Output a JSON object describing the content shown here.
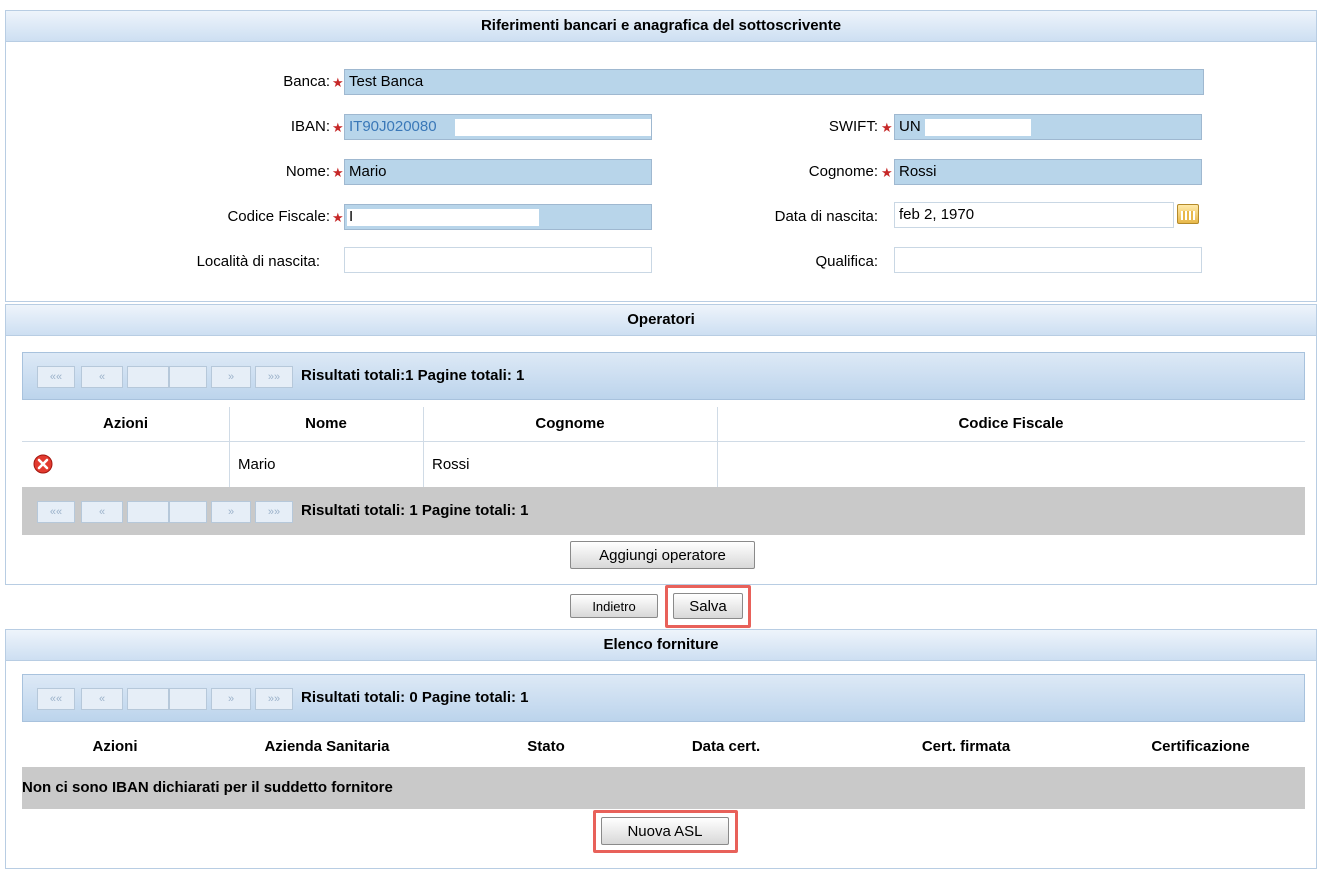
{
  "section1": {
    "title": "Riferimenti bancari e anagrafica del sottoscrivente",
    "banca_label": "Banca:",
    "banca_value": "Test Banca",
    "iban_label": "IBAN:",
    "iban_value": "IT90J020080",
    "swift_label": "SWIFT:",
    "swift_value": "UN",
    "nome_label": "Nome:",
    "nome_value": "Mario",
    "cognome_label": "Cognome:",
    "cognome_value": "Rossi",
    "cf_label": "Codice Fiscale:",
    "cf_value": "I",
    "data_label": "Data di nascita:",
    "data_value": "feb 2, 1970",
    "localita_label": "Località di nascita:",
    "localita_value": "",
    "qualifica_label": "Qualifica:",
    "qualifica_value": "",
    "required_mark": "★"
  },
  "operatori": {
    "title": "Operatori",
    "pager_top": "Risultati totali:1 Pagine totali: 1",
    "pager_bottom": "Risultati totali: 1 Pagine totali: 1",
    "columns": [
      "Azioni",
      "Nome",
      "Cognome",
      "Codice Fiscale"
    ],
    "rows": [
      {
        "nome": "Mario",
        "cognome": "Rossi",
        "codice_fiscale": ""
      }
    ],
    "add_button": "Aggiungi operatore"
  },
  "actions": {
    "back_button": "Indietro",
    "save_button": "Salva"
  },
  "forniture": {
    "title": "Elenco forniture",
    "pager": "Risultati totali: 0 Pagine totali: 1",
    "columns": [
      "Azioni",
      "Azienda Sanitaria",
      "Stato",
      "Data cert.",
      "Cert. firmata",
      "Certificazione"
    ],
    "empty_message": "Non ci sono IBAN dichiarati per il suddetto fornitore",
    "new_button": "Nuova ASL"
  },
  "pager_buttons": [
    "««",
    "«",
    "",
    "",
    "»",
    "»»"
  ],
  "colors": {
    "highlight": "#e8615a",
    "field_bg": "#b8d5ea",
    "header_bg": "#cddff2"
  }
}
